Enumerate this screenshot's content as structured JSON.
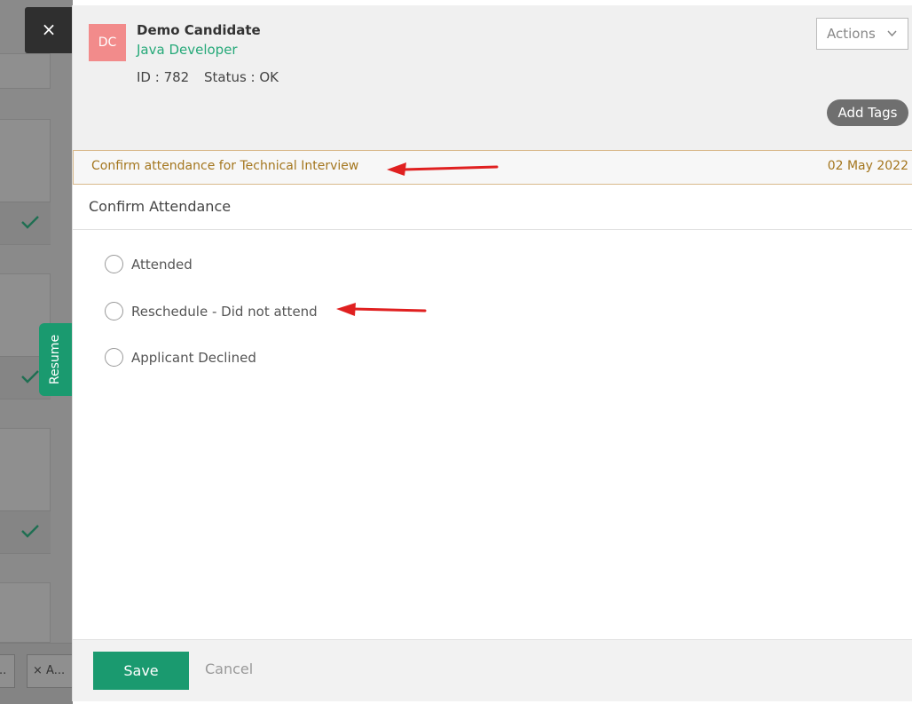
{
  "close_label": "×",
  "resume_tab": "Resume",
  "candidate": {
    "initials": "DC",
    "name": "Demo Candidate",
    "job": "Java Developer",
    "id_text": "ID : 782",
    "status_text": "Status : OK"
  },
  "header": {
    "actions_label": "Actions",
    "add_tags_label": "Add Tags"
  },
  "task": {
    "title": "Confirm attendance for Technical Interview",
    "date": "02 May 2022"
  },
  "form": {
    "title": "Confirm Attendance",
    "options": [
      {
        "label": "Attended",
        "selected": false
      },
      {
        "label": "Reschedule - Did not attend",
        "selected": false
      },
      {
        "label": "Applicant Declined",
        "selected": false
      }
    ]
  },
  "footer": {
    "save_label": "Save",
    "cancel_label": "Cancel"
  },
  "background": {
    "chips": [
      "..",
      "× A..."
    ]
  },
  "colors": {
    "accent": "#1a9a6f",
    "task_text": "#a4761e",
    "avatar": "#f28b8b",
    "annotation_arrow": "#e02020"
  }
}
